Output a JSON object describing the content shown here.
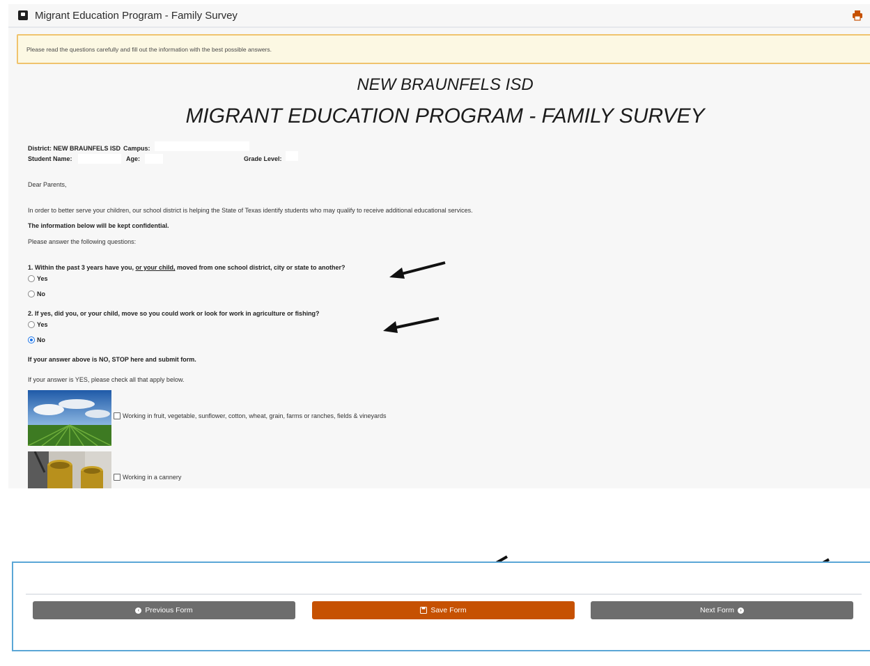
{
  "window": {
    "title": "Migrant Education Program - Family Survey",
    "print_icon": "print-icon"
  },
  "notice": "Please read the questions carefully and fill out the information with the best possible answers.",
  "headings": {
    "district": "NEW BRAUNFELS ISD",
    "program": "MIGRANT EDUCATION PROGRAM - FAMILY SURVEY"
  },
  "info": {
    "district_label": "District: NEW BRAUNFELS ISD",
    "campus_label": "Campus:",
    "student_name_label": "Student Name:",
    "age_label": "Age:",
    "grade_label": "Grade Level:"
  },
  "letter": {
    "greeting": "Dear Parents,",
    "intro": "In order to better serve your children, our school district is helping the State of Texas identify students who may qualify to receive additional educational services.",
    "confidential": "The information below will be kept confidential.",
    "instruction": "Please answer the following questions:"
  },
  "questions": {
    "q1": {
      "prefix": "1. Within the past 3 years have you,",
      "underlined": "or your child,",
      "suffix": "moved from one school district, city or state to another?",
      "options": [
        "Yes",
        "No"
      ],
      "selected": null
    },
    "q2": {
      "text": "2. If yes, did you, or your child, move so you could work or look for work in agriculture or fishing?",
      "options": [
        "Yes",
        "No"
      ],
      "selected": "No"
    }
  },
  "stop_note": "If your answer above is NO, STOP here and submit form.",
  "yes_note": "If your answer is YES, please check all that apply below.",
  "work_options": [
    {
      "label": "Working in fruit, vegetable, sunflower, cotton, wheat, grain, farms or ranches, fields & vineyards",
      "checked": false,
      "image": "farm-field-image"
    },
    {
      "label": "Working in a cannery",
      "checked": false,
      "image": "cannery-image"
    }
  ],
  "buttons": {
    "previous": "Previous Form",
    "save": "Save Form",
    "next": "Next Form"
  },
  "colors": {
    "save_button": "#c65102",
    "nav_button": "#6d6d6d",
    "notice_border": "#f0c36d",
    "panel_border": "#5aa6d6"
  }
}
